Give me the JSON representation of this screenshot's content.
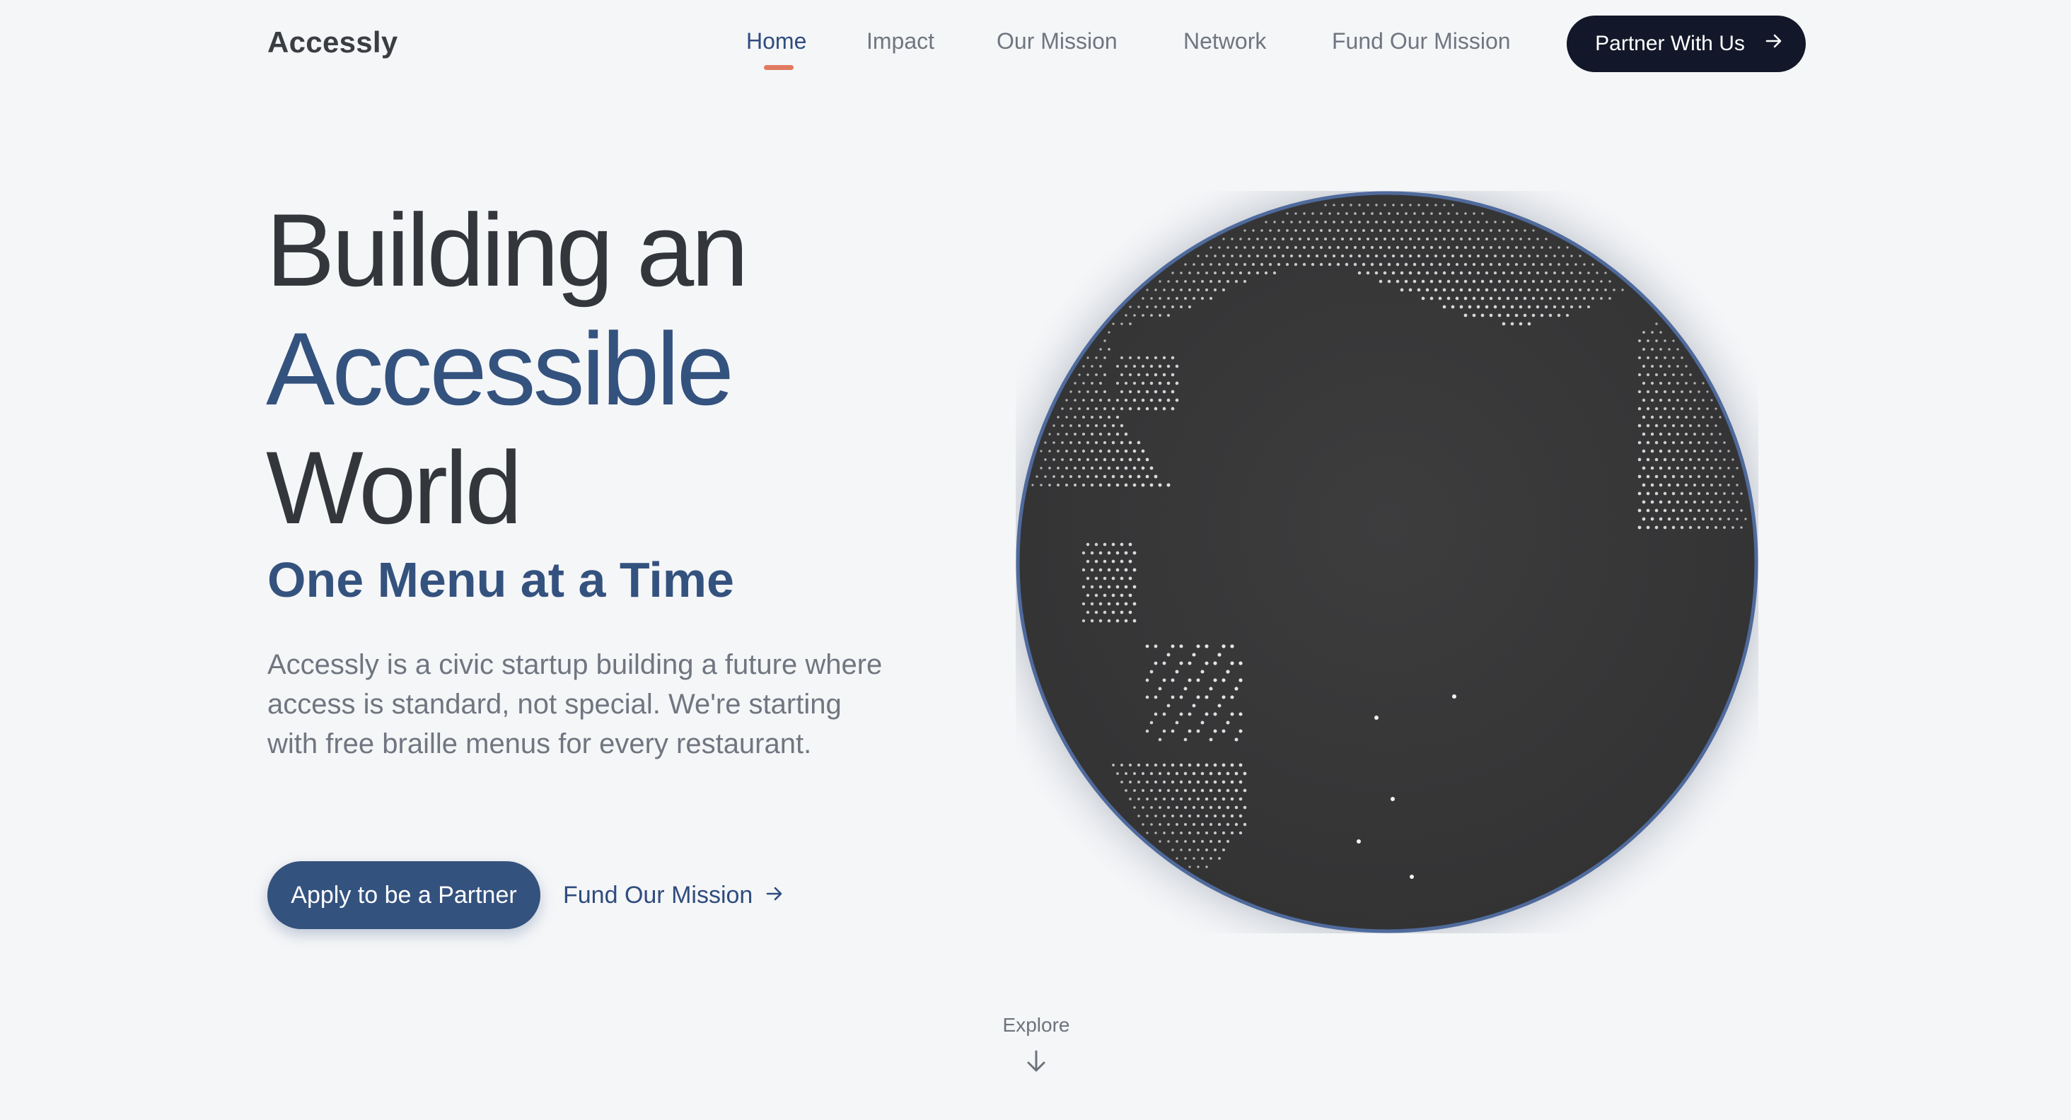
{
  "brand": {
    "name": "Accessly"
  },
  "nav": {
    "links": [
      {
        "label": "Home",
        "active": true
      },
      {
        "label": "Impact"
      },
      {
        "label": "Our Mission"
      },
      {
        "label": "Network"
      },
      {
        "label": "Fund Our Mission"
      }
    ],
    "cta_label": "Partner With Us"
  },
  "hero": {
    "title_line1": "Building an",
    "title_accent": "Accessible",
    "title_line3": "World",
    "subtitle": "One Menu at a Time",
    "description": "Accessly is a civic startup building a future where access is standard, not special. We're starting with free braille menus for every restaurant.",
    "primary_button": "Apply to be a Partner",
    "secondary_link": "Fund Our Mission"
  },
  "explore": {
    "label": "Explore"
  },
  "colors": {
    "accent": "#34527e",
    "underline": "#e07a5f",
    "dark_button": "#121829",
    "background": "#f5f6f8",
    "globe": "#3b3b3c"
  },
  "icons": {
    "nav_cta": "arrow-right-icon",
    "secondary_link": "arrow-right-icon",
    "explore": "arrow-down-icon",
    "globe": "dotted-globe-icon"
  }
}
